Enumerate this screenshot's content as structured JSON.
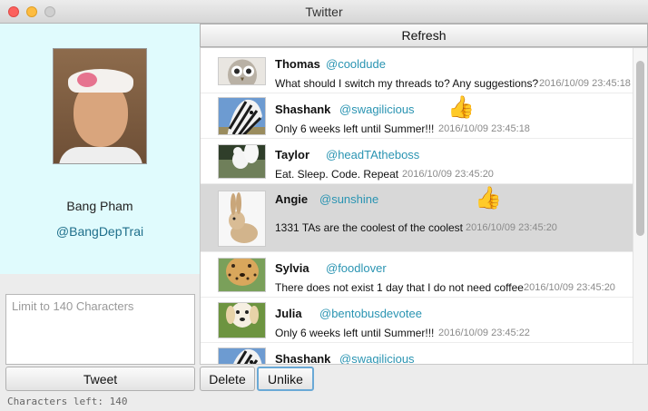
{
  "window": {
    "title": "Twitter"
  },
  "profile": {
    "name": "Bang Pham",
    "handle": "@BangDepTrai"
  },
  "composer": {
    "placeholder": "Limit to 140 Characters",
    "tweet_label": "Tweet",
    "chars_left": "Characters left: 140"
  },
  "toolbar": {
    "refresh_label": "Refresh",
    "delete_label": "Delete",
    "unlike_label": "Unlike"
  },
  "feed": {
    "tweets": [
      {
        "author": "Thomas",
        "handle": "@cooldude",
        "text": "What should I switch my threads to? Any suggestions?",
        "time": "2016/10/09 23:45:18",
        "thumb": "owl",
        "liked": false
      },
      {
        "author": "Shashank",
        "handle": "@swagilicious",
        "text": "Only 6 weeks left until Summer!!!",
        "time": "2016/10/09 23:45:18",
        "thumb": "zebra",
        "liked": true
      },
      {
        "author": "Taylor",
        "handle": "@headTAtheboss",
        "text": "Eat. Sleep. Code. Repeat",
        "time": "2016/10/09 23:45:20",
        "thumb": "squirrel",
        "liked": false
      },
      {
        "author": "Angie",
        "handle": "@sunshine",
        "text": "1331 TAs are the coolest of the coolest",
        "time": "2016/10/09 23:45:20",
        "thumb": "rabbit",
        "liked": true,
        "selected": true
      },
      {
        "author": "Sylvia",
        "handle": "@foodlover",
        "text": "There does not exist 1 day that I do not need coffee",
        "time": "2016/10/09 23:45:20",
        "thumb": "cheetah",
        "liked": false
      },
      {
        "author": "Julia",
        "handle": "@bentobusdevotee",
        "text": "Only 6 weeks left until Summer!!!",
        "time": "2016/10/09 23:45:22",
        "thumb": "puppy",
        "liked": false
      },
      {
        "author": "Shashank",
        "handle": "@swagilicious",
        "text": "",
        "time": "",
        "thumb": "zebra",
        "liked": false
      }
    ]
  },
  "icons": {
    "like": "thumbs-up-icon"
  },
  "colors": {
    "profile_bg": "#e0fbfd",
    "handle": "#2a94b2",
    "selected_row": "#d8d8d8",
    "like": "#e0a56a"
  }
}
